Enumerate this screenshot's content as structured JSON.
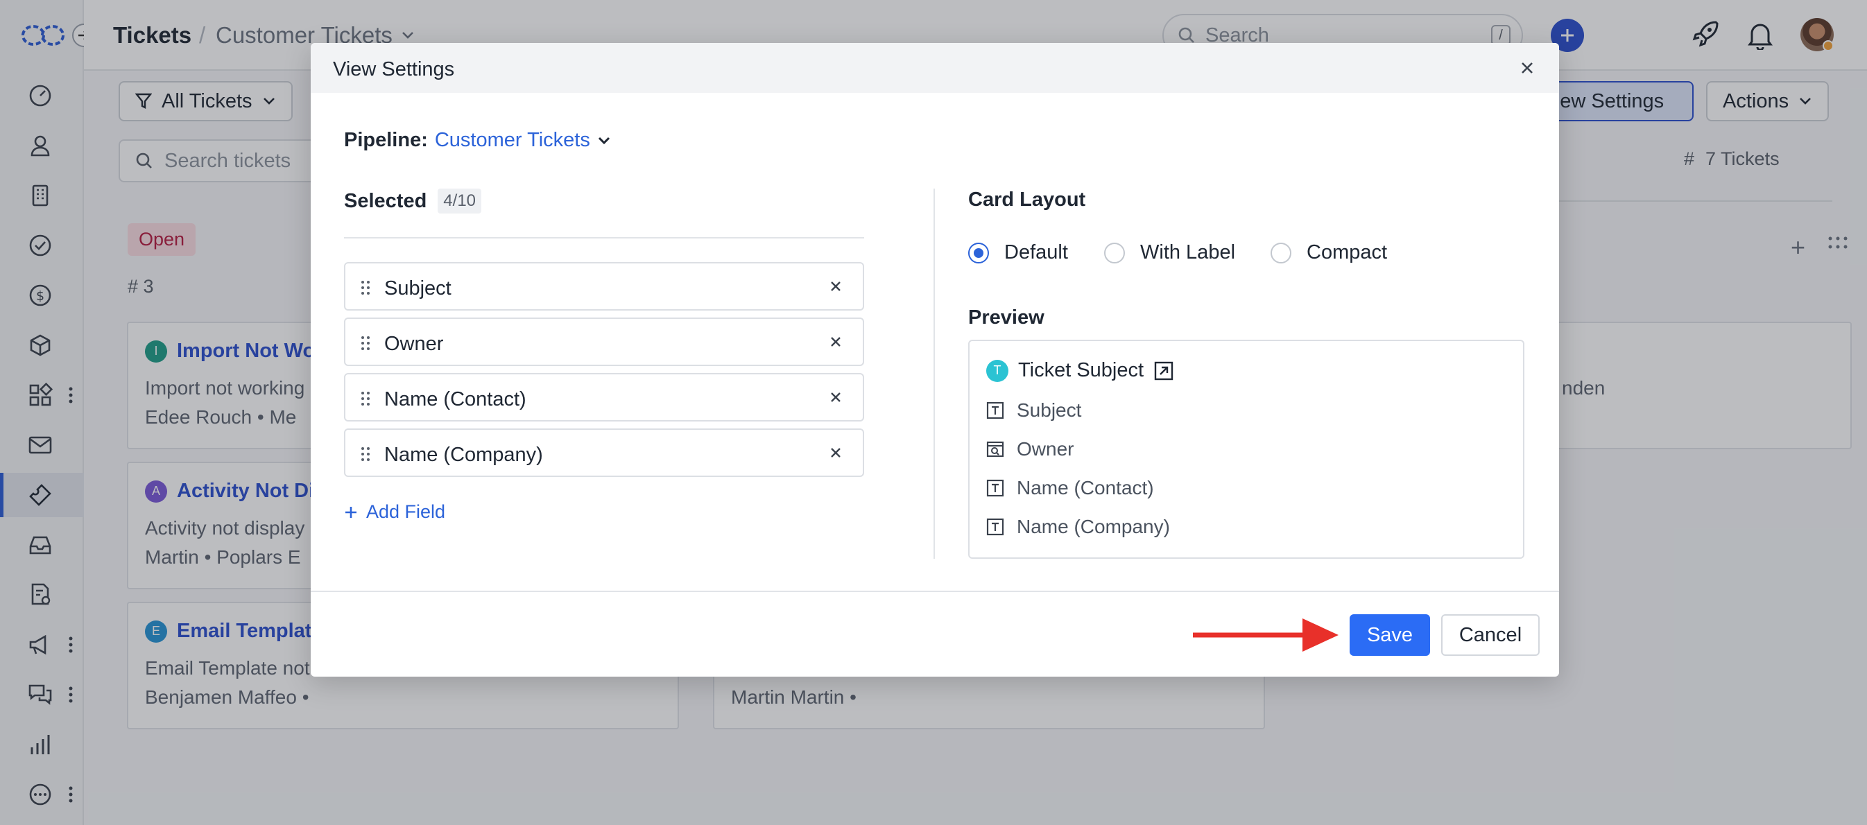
{
  "header": {
    "title": "Tickets",
    "separator": "/",
    "pipeline_name": "Customer Tickets",
    "search_placeholder": "Search",
    "search_shortcut": "/"
  },
  "sidebar": {
    "items": [
      {
        "icon": "dashboard-icon"
      },
      {
        "icon": "contacts-icon"
      },
      {
        "icon": "company-icon"
      },
      {
        "icon": "tasks-icon"
      },
      {
        "icon": "deals-icon"
      },
      {
        "icon": "products-icon"
      },
      {
        "icon": "apps-icon"
      },
      {
        "icon": "mail-icon"
      },
      {
        "icon": "tickets-icon",
        "active": true
      },
      {
        "icon": "inbox-icon"
      },
      {
        "icon": "forms-icon"
      },
      {
        "icon": "campaigns-icon"
      },
      {
        "icon": "chat-icon"
      },
      {
        "icon": "reports-icon"
      },
      {
        "icon": "more-icon"
      }
    ]
  },
  "toolbar": {
    "filter_label": "All Tickets",
    "view_settings_label": "View Settings",
    "actions_label": "Actions",
    "search_placeholder": "Search tickets",
    "ticket_count": "7 Tickets"
  },
  "board": {
    "column_status": "Open",
    "column_count": "3",
    "cards": [
      {
        "badge": "I",
        "badge_color": "#1f9e88",
        "title": "Import Not Wor",
        "desc": "Import not working",
        "meta": "Edee Rouch  •  Me"
      },
      {
        "badge": "A",
        "badge_color": "#7a5ad8",
        "title": "Activity Not Dis",
        "desc": "Activity not display",
        "meta": "Martin  •  Poplars E"
      },
      {
        "badge": "E",
        "badge_color": "#2694d6",
        "title": "Email Template",
        "desc": "Email Template not",
        "meta": "Benjamen Maffeo  •"
      }
    ],
    "second_column_meta": "Martin Martin  •",
    "right_card_text": "nden"
  },
  "modal": {
    "title": "View Settings",
    "pipeline_label": "Pipeline:",
    "pipeline_value": "Customer Tickets",
    "selected_label": "Selected",
    "selected_count": "4/10",
    "fields": [
      "Subject",
      "Owner",
      "Name (Contact)",
      "Name (Company)"
    ],
    "add_field_label": "Add Field",
    "card_layout_label": "Card Layout",
    "layout_options": [
      {
        "label": "Default",
        "selected": true
      },
      {
        "label": "With Label",
        "selected": false
      },
      {
        "label": "Compact",
        "selected": false
      }
    ],
    "preview_label": "Preview",
    "preview_badge": "T",
    "preview_title": "Ticket Subject",
    "preview_rows": [
      {
        "icon": "text-field-icon",
        "label": "Subject"
      },
      {
        "icon": "lookup-field-icon",
        "label": "Owner"
      },
      {
        "icon": "text-field-icon",
        "label": "Name (Contact)"
      },
      {
        "icon": "text-field-icon",
        "label": "Name (Company)"
      }
    ],
    "save_label": "Save",
    "cancel_label": "Cancel"
  },
  "colors": {
    "accent": "#2b6cf5",
    "arrow": "#e8302a",
    "open_tag_bg": "#fbdde3",
    "open_tag_text": "#b61c41"
  }
}
